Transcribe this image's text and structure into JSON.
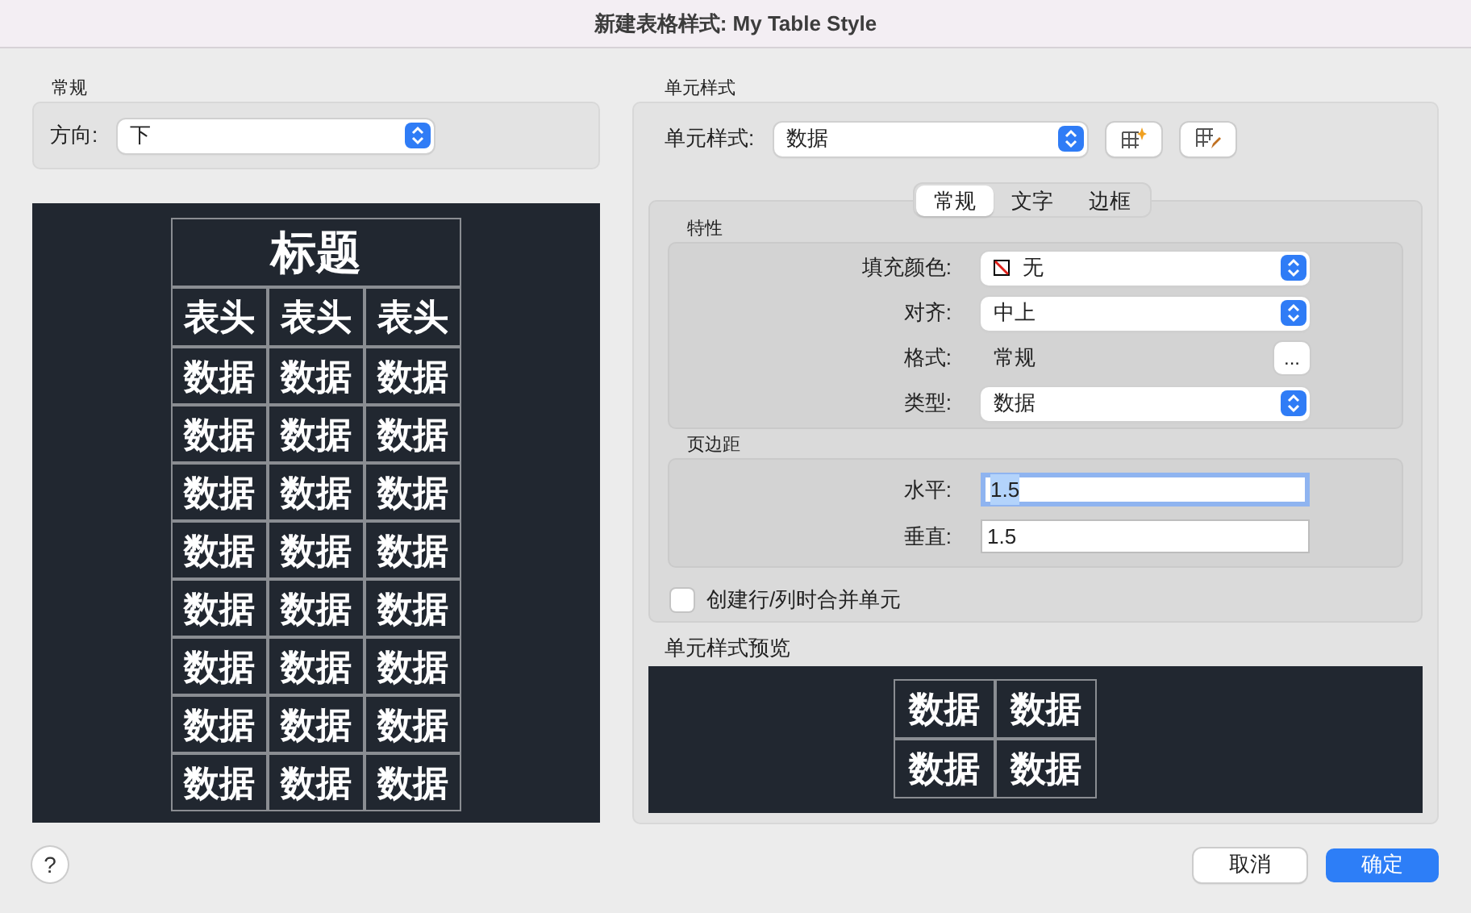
{
  "window": {
    "title": "新建表格样式: My Table Style"
  },
  "general": {
    "label": "常规",
    "direction": {
      "label": "方向:",
      "value": "下"
    }
  },
  "table_preview": {
    "title": "标题",
    "header_row": [
      "表头",
      "表头",
      "表头"
    ],
    "rows": [
      [
        "数据",
        "数据",
        "数据"
      ],
      [
        "数据",
        "数据",
        "数据"
      ],
      [
        "数据",
        "数据",
        "数据"
      ],
      [
        "数据",
        "数据",
        "数据"
      ],
      [
        "数据",
        "数据",
        "数据"
      ],
      [
        "数据",
        "数据",
        "数据"
      ],
      [
        "数据",
        "数据",
        "数据"
      ],
      [
        "数据",
        "数据",
        "数据"
      ]
    ]
  },
  "cell_style": {
    "label": "单元样式",
    "style_select": {
      "label": "单元样式:",
      "value": "数据"
    },
    "tabs": [
      {
        "label": "常规",
        "selected": true
      },
      {
        "label": "文字",
        "selected": false
      },
      {
        "label": "边框",
        "selected": false
      }
    ],
    "properties": {
      "label": "特性",
      "fields": [
        {
          "kind": "color-select",
          "label": "填充颜色:",
          "value": "无"
        },
        {
          "kind": "select",
          "label": "对齐:",
          "value": "中上"
        },
        {
          "kind": "text-button",
          "label": "格式:",
          "value": "常规",
          "button": "..."
        },
        {
          "kind": "select",
          "label": "类型:",
          "value": "数据"
        }
      ]
    },
    "margins": {
      "label": "页边距",
      "fields": [
        {
          "label": "水平:",
          "value": "1.5",
          "focused": true
        },
        {
          "label": "垂直:",
          "value": "1.5",
          "focused": false
        }
      ]
    },
    "merge_checkbox": {
      "label": "创建行/列时合并单元",
      "checked": false
    },
    "preview": {
      "label": "单元样式预览",
      "rows": [
        [
          "数据",
          "数据"
        ],
        [
          "数据",
          "数据"
        ]
      ]
    }
  },
  "buttons": [
    {
      "kind": "help",
      "label": "?"
    },
    {
      "kind": "cancel",
      "label": "取消"
    },
    {
      "kind": "ok",
      "label": "确定"
    }
  ]
}
